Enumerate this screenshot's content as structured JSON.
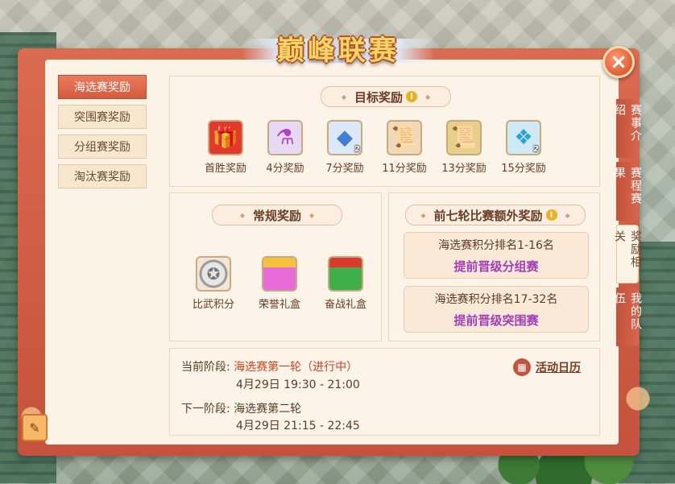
{
  "title": "巅峰联赛",
  "close_icon": "×",
  "subtabs": [
    {
      "label": "海选赛奖励",
      "active": true
    },
    {
      "label": "突围赛奖励",
      "active": false
    },
    {
      "label": "分组赛奖励",
      "active": false
    },
    {
      "label": "淘汰赛奖励",
      "active": false
    }
  ],
  "side_tabs": [
    {
      "label": "赛事介绍",
      "active": false
    },
    {
      "label": "赛程赛果",
      "active": false
    },
    {
      "label": "奖励相关",
      "active": true
    },
    {
      "label": "我的队伍",
      "active": false
    }
  ],
  "goal": {
    "header": "目标奖励",
    "info": "i",
    "items": [
      {
        "label": "首胜奖励",
        "icon": "gift-box-icon",
        "glyph": "🎁",
        "count": ""
      },
      {
        "label": "4分奖励",
        "icon": "potion-bottle-icon",
        "glyph": "⚗",
        "count": ""
      },
      {
        "label": "7分奖励",
        "icon": "blue-ore-icon",
        "glyph": "◆",
        "count": "2"
      },
      {
        "label": "11分奖励",
        "icon": "scroll-icon",
        "glyph": "📜",
        "count": ""
      },
      {
        "label": "13分奖励",
        "icon": "golden-scroll-icon",
        "glyph": "📜",
        "count": ""
      },
      {
        "label": "15分奖励",
        "icon": "crystal-icon",
        "glyph": "❖",
        "count": "2"
      }
    ]
  },
  "regular": {
    "header": "常规奖励",
    "items": [
      {
        "label": "比武积分",
        "icon": "silver-coin-icon",
        "glyph": "✪"
      },
      {
        "label": "荣誉礼盒",
        "icon": "honor-gift-box-icon",
        "glyph": ""
      },
      {
        "label": "奋战礼盒",
        "icon": "battle-gift-box-icon",
        "glyph": ""
      }
    ]
  },
  "extra": {
    "header": "前七轮比赛额外奖励",
    "info": "i",
    "ranks": [
      {
        "title": "海选赛积分排名1-16名",
        "reward": "提前晋级分组赛"
      },
      {
        "title": "海选赛积分排名17-32名",
        "reward": "提前晋级突围赛"
      }
    ]
  },
  "stage": {
    "current_key": "当前阶段:",
    "current_value": "海选赛第一轮（进行中）",
    "current_time": "4月29日  19:30  -  21:00",
    "next_key": "下一阶段:",
    "next_value": "海选赛第二轮",
    "next_time": "4月29日  21:15  -  22:45",
    "calendar_label": "活动日历",
    "calendar_icon": "▦"
  },
  "note_icon": "✎"
}
